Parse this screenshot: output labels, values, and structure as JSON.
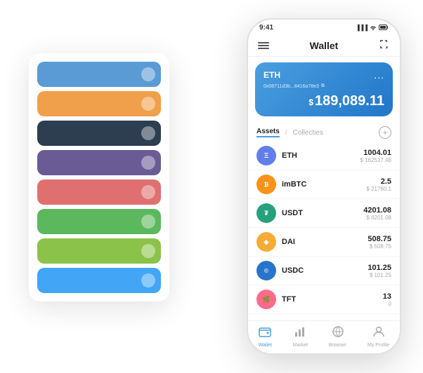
{
  "statusBar": {
    "time": "9:41",
    "signal": "▐▐▐",
    "wifi": "WiFi",
    "battery": "🔋"
  },
  "header": {
    "title": "Wallet",
    "menuIcon": "≡",
    "expandIcon": "⛶"
  },
  "ethCard": {
    "name": "ETH",
    "address": "0x08711d3b...8416a78e3",
    "copyIcon": "⧉",
    "moreIcon": "...",
    "balancePrefix": "$",
    "balance": "189,089.11"
  },
  "assetsSection": {
    "activeTab": "Assets",
    "inactiveTab": "Collecties",
    "divider": "/",
    "addIcon": "+"
  },
  "assets": [
    {
      "symbol": "ETH",
      "iconText": "Ξ",
      "iconClass": "icon-eth",
      "amount": "1004.01",
      "usd": "$ 162517.48"
    },
    {
      "symbol": "imBTC",
      "iconText": "₿",
      "iconClass": "icon-imbtc",
      "amount": "2.5",
      "usd": "$ 21760.1"
    },
    {
      "symbol": "USDT",
      "iconText": "₮",
      "iconClass": "icon-usdt",
      "amount": "4201.08",
      "usd": "$ 4201.08"
    },
    {
      "symbol": "DAI",
      "iconText": "◈",
      "iconClass": "icon-dai",
      "amount": "508.75",
      "usd": "$ 508.75"
    },
    {
      "symbol": "USDC",
      "iconText": "©",
      "iconClass": "icon-usdc",
      "amount": "101.25",
      "usd": "$ 101.25"
    },
    {
      "symbol": "TFT",
      "iconText": "🌿",
      "iconClass": "icon-tft",
      "amount": "13",
      "usd": "0"
    }
  ],
  "bottomNav": [
    {
      "id": "wallet",
      "label": "Wallet",
      "icon": "◎",
      "active": true
    },
    {
      "id": "market",
      "label": "Market",
      "icon": "📊",
      "active": false
    },
    {
      "id": "browser",
      "label": "Browser",
      "icon": "🔍",
      "active": false
    },
    {
      "id": "profile",
      "label": "My Profile",
      "icon": "👤",
      "active": false
    }
  ],
  "cardList": [
    {
      "color": "card-blue",
      "id": "card-1"
    },
    {
      "color": "card-orange",
      "id": "card-2"
    },
    {
      "color": "card-dark",
      "id": "card-3"
    },
    {
      "color": "card-purple",
      "id": "card-4"
    },
    {
      "color": "card-red",
      "id": "card-5"
    },
    {
      "color": "card-green",
      "id": "card-6"
    },
    {
      "color": "card-light-green",
      "id": "card-7"
    },
    {
      "color": "card-sky",
      "id": "card-8"
    }
  ]
}
